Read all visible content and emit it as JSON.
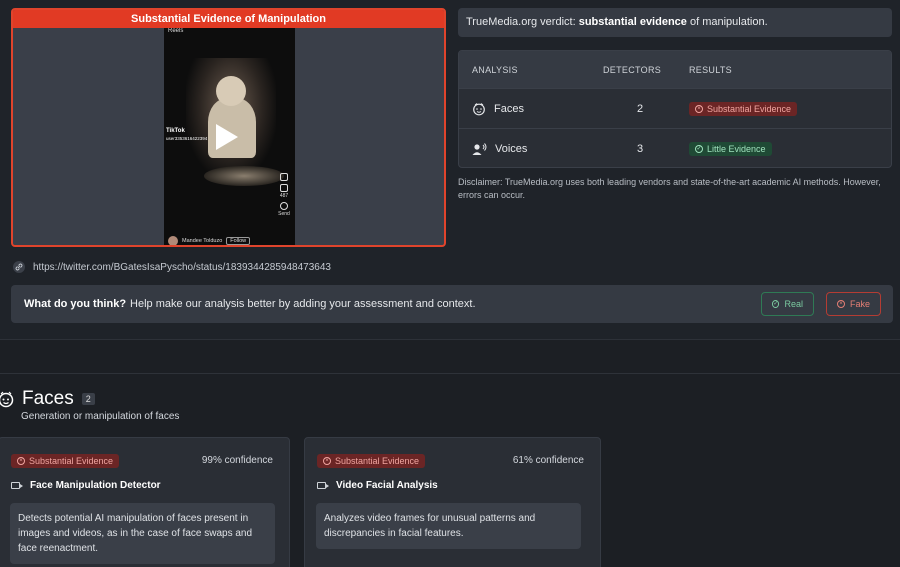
{
  "media": {
    "banner": "Substantial Evidence of Manipulation",
    "video": {
      "top_text": "Reels",
      "platform": "TikTok",
      "user_handle": "user3353616422394",
      "stat_count": "487",
      "share_label": "Send",
      "author": "Mandee Tolduzo",
      "follow_label": "Follow"
    }
  },
  "verdict": {
    "prefix": "TrueMedia.org verdict: ",
    "strong": "substantial evidence",
    "suffix": " of manipulation."
  },
  "analysis": {
    "headers": [
      "ANALYSIS",
      "DETECTORS",
      "RESULTS"
    ],
    "rows": [
      {
        "icon": "face-icon",
        "name": "Faces",
        "detectors": "2",
        "result": "Substantial Evidence",
        "status": "red"
      },
      {
        "icon": "voice-icon",
        "name": "Voices",
        "detectors": "3",
        "result": "Little Evidence",
        "status": "green"
      }
    ]
  },
  "disclaimer": "Disclaimer: TrueMedia.org uses both leading vendors and state-of-the-art academic AI methods. However, errors can occur.",
  "url": "https://twitter.com/BGatesIsaPyscho/status/1839344285948473643",
  "feedback": {
    "question": "What do you think?",
    "prompt": "Help make our analysis better by adding your assessment and context.",
    "real_label": "Real",
    "fake_label": "Fake"
  },
  "faces_section": {
    "title": "Faces",
    "count": "2",
    "subtitle": "Generation or manipulation of faces",
    "cards": [
      {
        "badge": "Substantial Evidence",
        "confidence": "99% confidence",
        "title": "Face Manipulation Detector",
        "description": "Detects potential AI manipulation of faces present in images and videos, as in the case of face swaps and face reenactment."
      },
      {
        "badge": "Substantial Evidence",
        "confidence": "61% confidence",
        "title": "Video Facial Analysis",
        "description": "Analyzes video frames for unusual patterns and discrepancies in facial features."
      }
    ]
  },
  "colors": {
    "accent_red": "#e13a24",
    "badge_red": "#6b2525",
    "badge_green": "#1f4a35",
    "background": "#1f2329"
  }
}
